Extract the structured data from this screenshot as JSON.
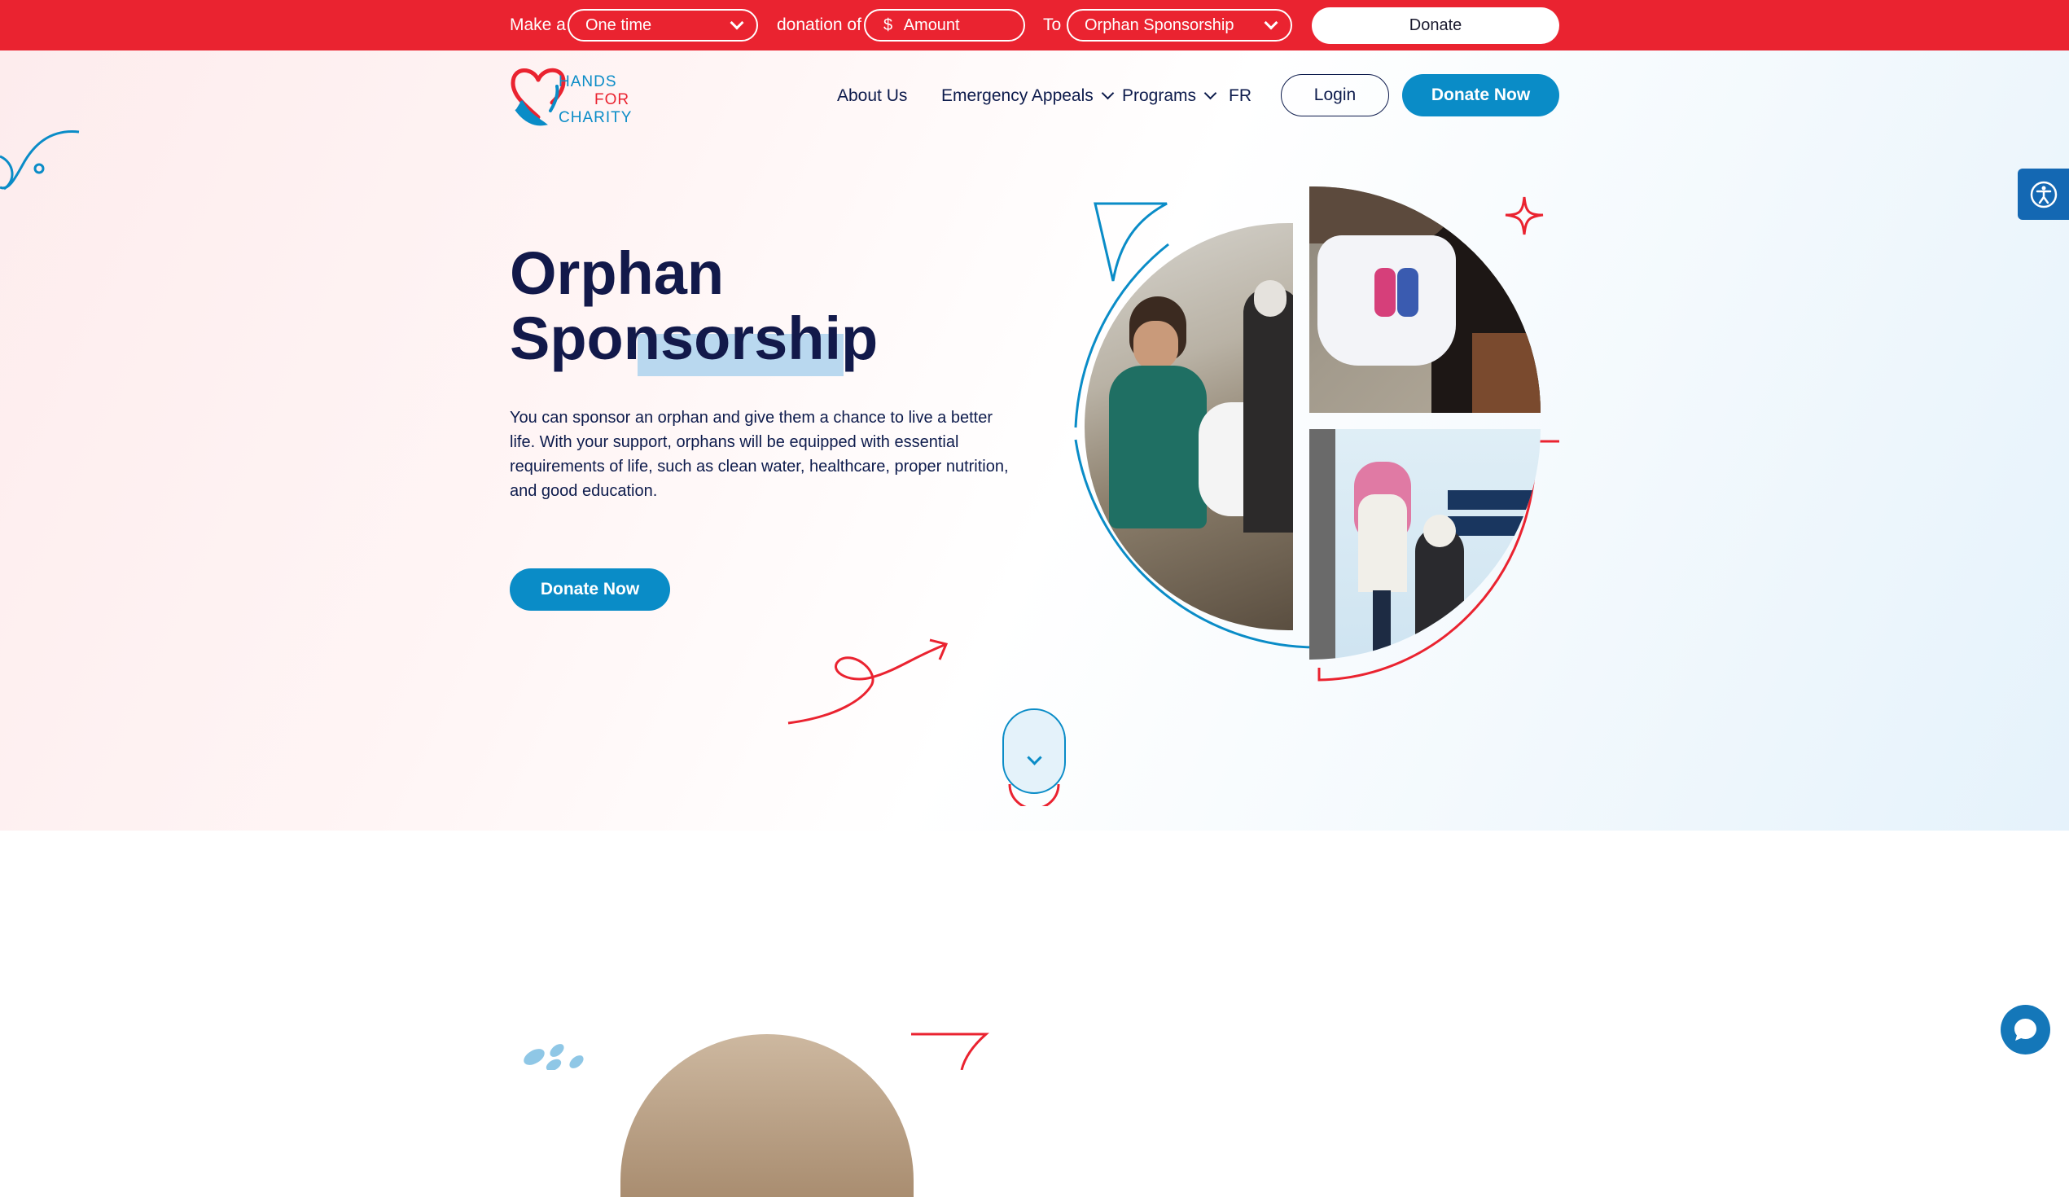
{
  "donation_bar": {
    "make_a": "Make a",
    "frequency_value": "One time",
    "donation_of": "donation of",
    "currency_symbol": "$",
    "amount_placeholder": "Amount",
    "to": "To",
    "cause_value": "Orphan Sponsorship",
    "donate_label": "Donate"
  },
  "logo": {
    "line1": "HANDS",
    "line2": "FOR",
    "line3": "CHARITY"
  },
  "nav": {
    "about": "About Us",
    "emergency": "Emergency Appeals",
    "programs": "Programs",
    "lang": "FR",
    "login": "Login",
    "donate_now": "Donate Now"
  },
  "hero": {
    "title_line1": "Orphan",
    "title_line2": "Sponsorship",
    "description": "You can sponsor an orphan and give them a chance to live a better life. With your support, orphans will be equipped with essential requirements of life, such as clean water, healthcare, proper nutrition, and good education.",
    "cta": "Donate Now"
  },
  "colors": {
    "brand_red": "#ea2330",
    "brand_blue": "#0a8cc7",
    "navy": "#12194a"
  },
  "icons": {
    "accessibility": "accessibility-icon",
    "chat": "chat-icon",
    "scroll_down": "chevron-down-icon"
  }
}
